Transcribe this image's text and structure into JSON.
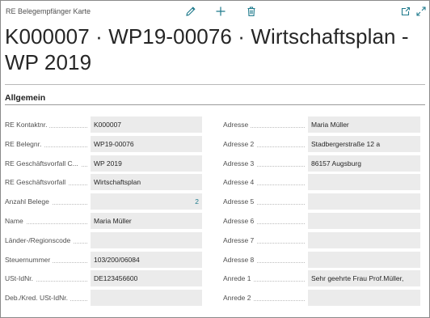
{
  "header": {
    "caption": "RE Belegempfänger Karte",
    "title": "K000007 · WP19-00076 · Wirtschaftsplan - WP 2019",
    "actions": [
      "edit-icon",
      "add-icon",
      "delete-icon",
      "open-new-window-icon",
      "expand-icon"
    ]
  },
  "section": {
    "title": "Allgemein"
  },
  "left_fields": [
    {
      "label": "RE Kontaktnr.",
      "value": "K000007"
    },
    {
      "label": "RE Belegnr.",
      "value": "WP19-00076"
    },
    {
      "label": "RE Geschäftsvorfall C...",
      "value": "WP 2019"
    },
    {
      "label": "RE Geschäftsvorfall",
      "value": "Wirtschaftsplan"
    },
    {
      "label": "Anzahl Belege",
      "value": "2"
    },
    {
      "label": "Name",
      "value": "Maria Müller"
    },
    {
      "label": "Länder-/Regionscode",
      "value": ""
    },
    {
      "label": "Steuernummer",
      "value": "103/200/06084"
    },
    {
      "label": "USt-IdNr.",
      "value": "DE123456600"
    },
    {
      "label": "Deb./Kred. USt-IdNr.",
      "value": ""
    }
  ],
  "right_fields": [
    {
      "label": "Adresse",
      "value": "Maria Müller"
    },
    {
      "label": "Adresse 2",
      "value": "Stadbergerstraße 12 a"
    },
    {
      "label": "Adresse 3",
      "value": "86157 Augsburg"
    },
    {
      "label": "Adresse 4",
      "value": ""
    },
    {
      "label": "Adresse 5",
      "value": ""
    },
    {
      "label": "Adresse 6",
      "value": ""
    },
    {
      "label": "Adresse 7",
      "value": ""
    },
    {
      "label": "Adresse 8",
      "value": ""
    },
    {
      "label": "Anrede 1",
      "value": "Sehr geehrte Frau Prof.Müller,"
    },
    {
      "label": "Anrede 2",
      "value": ""
    }
  ],
  "colors": {
    "accent": "#1f7a8c",
    "field_background": "#ebebeb"
  }
}
